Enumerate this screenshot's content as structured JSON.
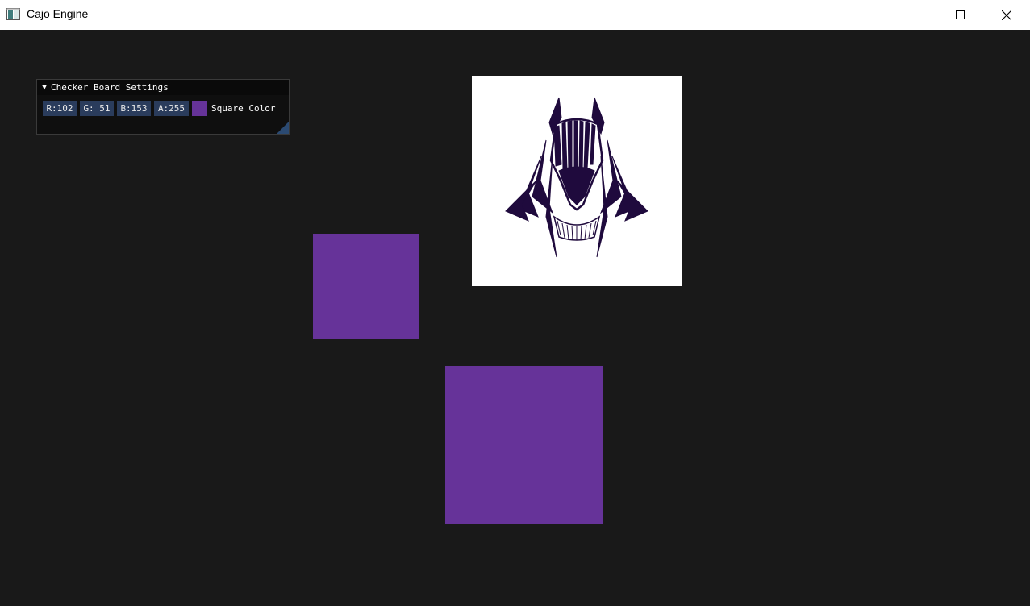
{
  "window": {
    "title": "Cajo Engine",
    "controls": [
      "minimize",
      "maximize",
      "close"
    ]
  },
  "imgui_panel": {
    "title": "Checker Board Settings",
    "r_field": "R:102",
    "g_field": "G: 51",
    "b_field": "B:153",
    "a_field": "A:255",
    "color_label": "Square Color",
    "color": {
      "r": 102,
      "g": 51,
      "b": 153,
      "a": 255
    }
  },
  "scene": {
    "background": "#191919",
    "square_color": "#663399",
    "texture": "anubis-head-icon"
  }
}
